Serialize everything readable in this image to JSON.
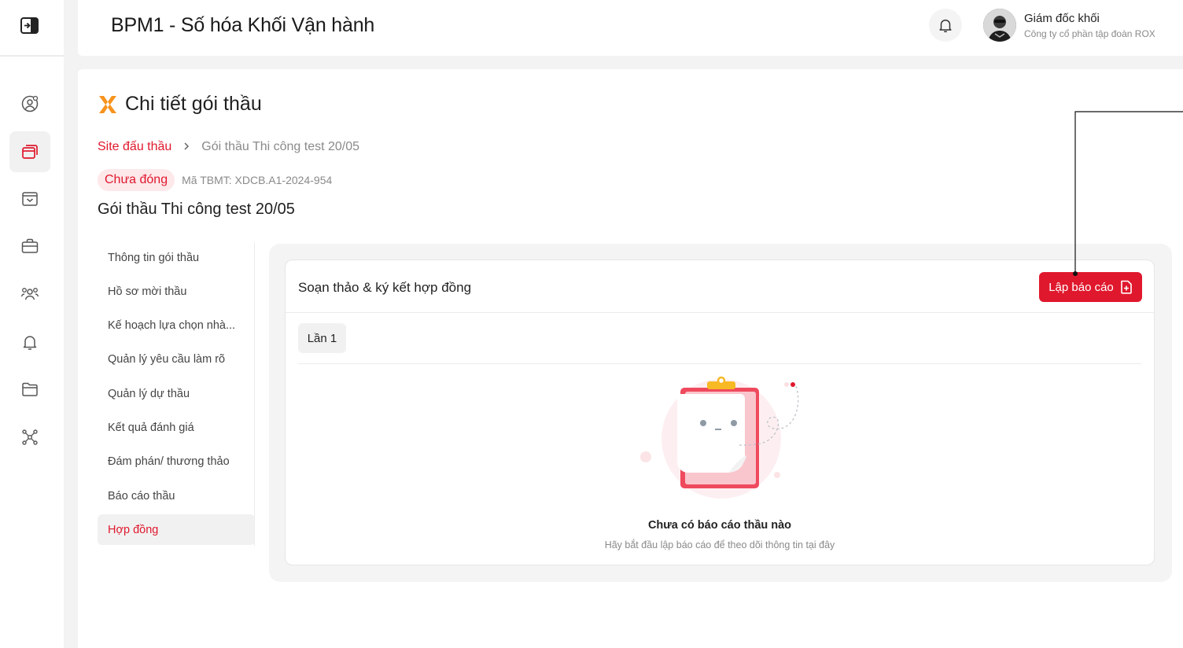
{
  "header": {
    "app_title": "BPM1 - Số hóa Khối Vận hành",
    "user_name": "Giám đốc khối",
    "user_org": "Công ty cổ phần tập đoàn ROX"
  },
  "sidebar": {
    "items": [
      {
        "icon": "user-settings-icon"
      },
      {
        "icon": "windows-icon",
        "active": true
      },
      {
        "icon": "inbox-icon"
      },
      {
        "icon": "briefcase-icon"
      },
      {
        "icon": "users-icon"
      },
      {
        "icon": "bell-icon"
      },
      {
        "icon": "folder-icon"
      },
      {
        "icon": "network-icon"
      }
    ]
  },
  "page": {
    "title": "Chi tiết gói thầu",
    "breadcrumb": {
      "link": "Site đấu thầu",
      "current": "Gói thầu Thi công test 20/05"
    },
    "status": "Chưa đóng",
    "code": "Mã TBMT: XDCB.A1-2024-954",
    "package_title": "Gói thầu Thi công test 20/05"
  },
  "menu": {
    "items": [
      "Thông tin gói thầu",
      "Hồ sơ mời thầu",
      "Kế hoạch lựa chọn nhà...",
      "Quản lý yêu cầu làm rõ",
      "Quản lý dự thầu",
      "Kết quả đánh giá",
      "Đám phán/ thương thảo",
      "Báo cáo thầu",
      "Hợp đồng"
    ],
    "active_index": 8
  },
  "card": {
    "title": "Soạn thảo & ký kết hợp đồng",
    "report_button": "Lập báo cáo",
    "tab": "Lần 1",
    "empty_title": "Chưa có báo cáo thầu nào",
    "empty_subtitle": "Hãy bắt đầu lập báo cáo để theo dõi thông tin tại đây"
  },
  "colors": {
    "accent": "#e0182d",
    "logo_orange": "#f7931e"
  }
}
